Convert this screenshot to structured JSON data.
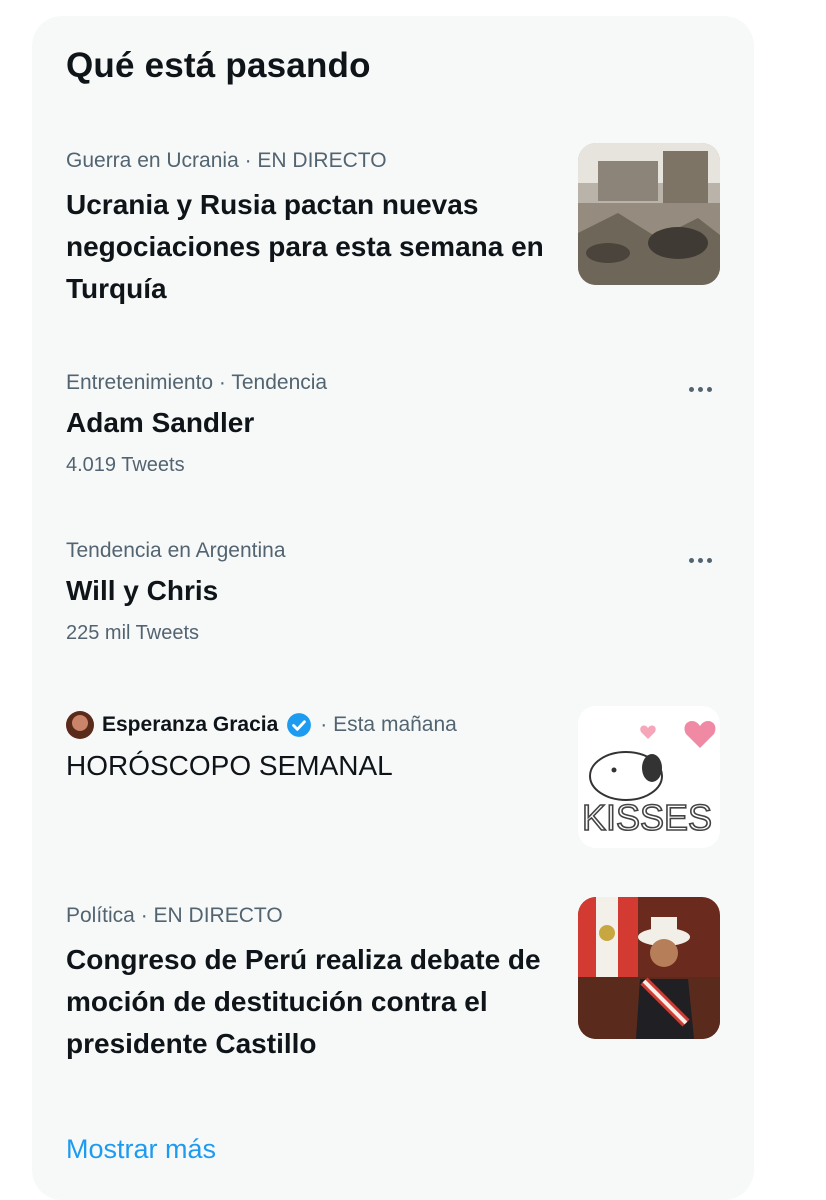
{
  "panel": {
    "title": "Qué está pasando"
  },
  "trends": [
    {
      "meta": "Guerra en Ucrania · EN DIRECTO",
      "title": "Ucrania y Rusia pactan nuevas negociaciones para esta semana en Turquía"
    },
    {
      "meta": "Entretenimiento · Tendencia",
      "title": "Adam Sandler",
      "count": "4.019 Tweets"
    },
    {
      "meta": "Tendencia en Argentina",
      "title": "Will y Chris",
      "count": "225 mil Tweets"
    },
    {
      "author": "Esperanza Gracia",
      "time": "· Esta mañana",
      "title": "HORÓSCOPO SEMANAL",
      "thumb_text": "KISSES"
    },
    {
      "meta": "Política · EN DIRECTO",
      "title": "Congreso de Perú realiza debate de moción de destitución contra el presidente Castillo"
    }
  ],
  "show_more": "Mostrar más",
  "colors": {
    "accent": "#1d9bf0",
    "panel_bg": "#f7f9f9",
    "secondary_text": "#536471"
  },
  "icons": {
    "more": "more-horizontal-icon",
    "verified": "verified-badge-icon"
  }
}
